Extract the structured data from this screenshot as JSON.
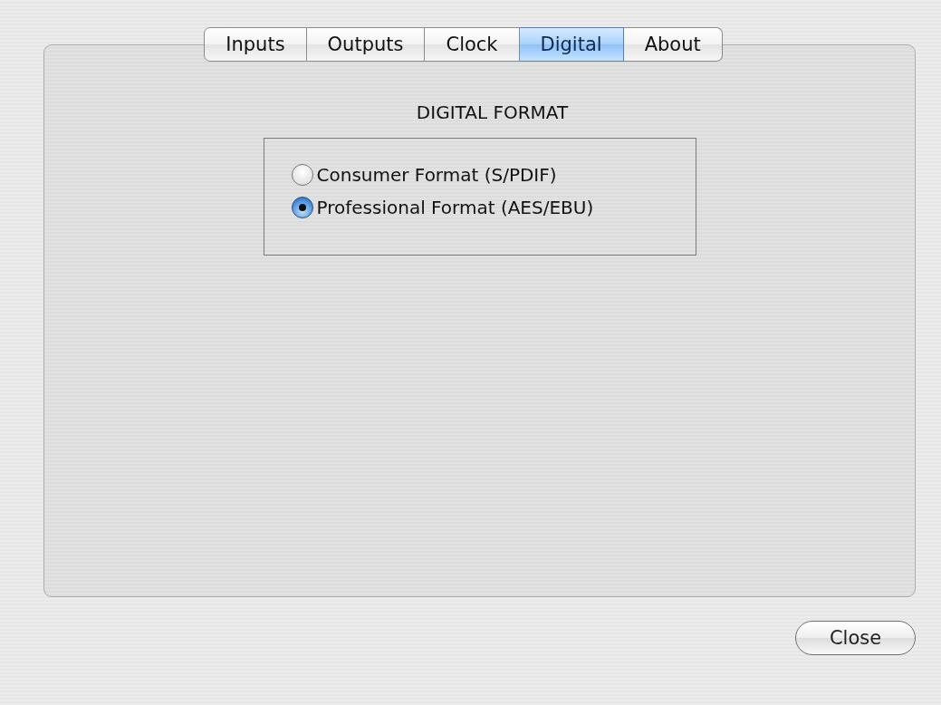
{
  "tabs": [
    {
      "label": "Inputs",
      "selected": false
    },
    {
      "label": "Outputs",
      "selected": false
    },
    {
      "label": "Clock",
      "selected": false
    },
    {
      "label": "Digital",
      "selected": true
    },
    {
      "label": "About",
      "selected": false
    }
  ],
  "digital_format": {
    "heading": "DIGITAL FORMAT",
    "options": [
      {
        "label": "Consumer Format (S/PDIF)",
        "selected": false
      },
      {
        "label": "Professional Format (AES/EBU)",
        "selected": true
      }
    ]
  },
  "buttons": [
    {
      "label": "Close"
    }
  ]
}
